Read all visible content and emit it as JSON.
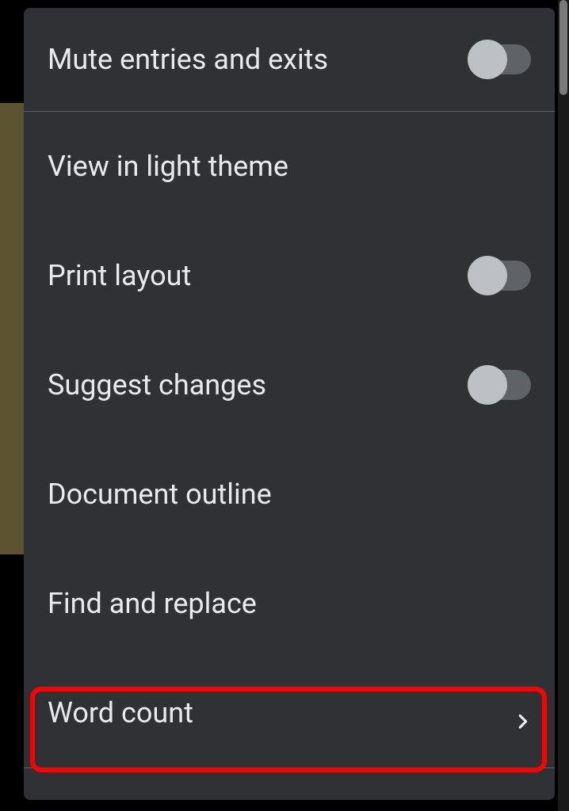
{
  "menu": {
    "items": [
      {
        "label": "Mute entries and exits",
        "type": "toggle",
        "enabled": false
      },
      {
        "label": "View in light theme",
        "type": "plain"
      },
      {
        "label": "Print layout",
        "type": "toggle",
        "enabled": false
      },
      {
        "label": "Suggest changes",
        "type": "toggle",
        "enabled": false
      },
      {
        "label": "Document outline",
        "type": "plain"
      },
      {
        "label": "Find and replace",
        "type": "plain"
      },
      {
        "label": "Word count",
        "type": "chevron"
      }
    ]
  }
}
